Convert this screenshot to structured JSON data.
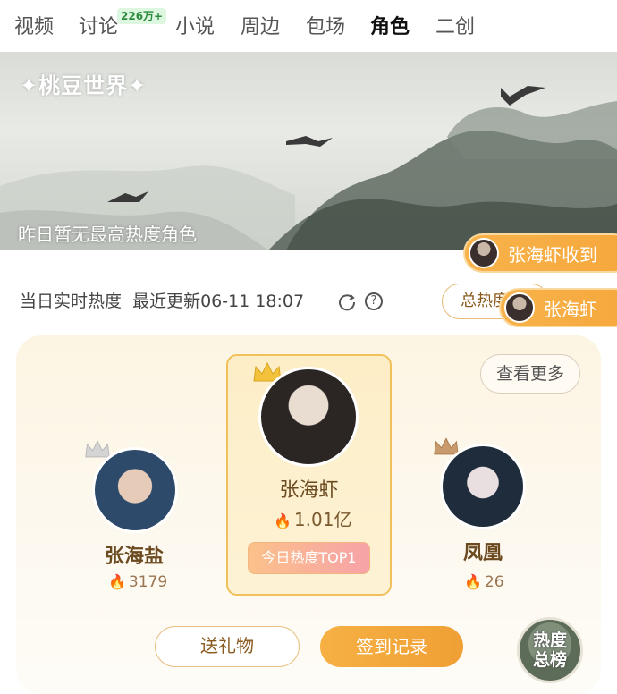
{
  "tabs": [
    {
      "label": "视频"
    },
    {
      "label": "讨论",
      "badge": "226万+"
    },
    {
      "label": "小说"
    },
    {
      "label": "周边"
    },
    {
      "label": "包场"
    },
    {
      "label": "角色",
      "active": true
    },
    {
      "label": "二创"
    }
  ],
  "banner": {
    "brand": "✦桃豆世界✦",
    "caption": "昨日暂无最高热度角色"
  },
  "danmaku": [
    {
      "text": "张海虾收到"
    },
    {
      "text": "张海虾"
    }
  ],
  "status": {
    "label": "当日实时热度",
    "updated": "最近更新06-11 18:07",
    "refresh_icon": "refresh-icon",
    "help_icon": "?",
    "total_button": "总热度"
  },
  "ranking": {
    "more_button": "查看更多",
    "first": {
      "name": "张海虾",
      "heat": "1.01亿",
      "tag": "今日热度TOP1",
      "crown_color": "#f3c23c"
    },
    "second": {
      "name": "张海盐",
      "heat": "3179",
      "crown_color": "#c8c8c8"
    },
    "third": {
      "name": "凤凰",
      "heat": "26",
      "crown_color": "#c99a6b"
    }
  },
  "actions": {
    "gift_button": "送礼物",
    "checkin_button": "签到记录"
  },
  "float_badge": {
    "line1": "热度",
    "line2": "总榜"
  },
  "colors": {
    "accent_orange": "#f5a83c",
    "gold_border": "#f2c05a",
    "brown_text": "#6b4a20"
  }
}
